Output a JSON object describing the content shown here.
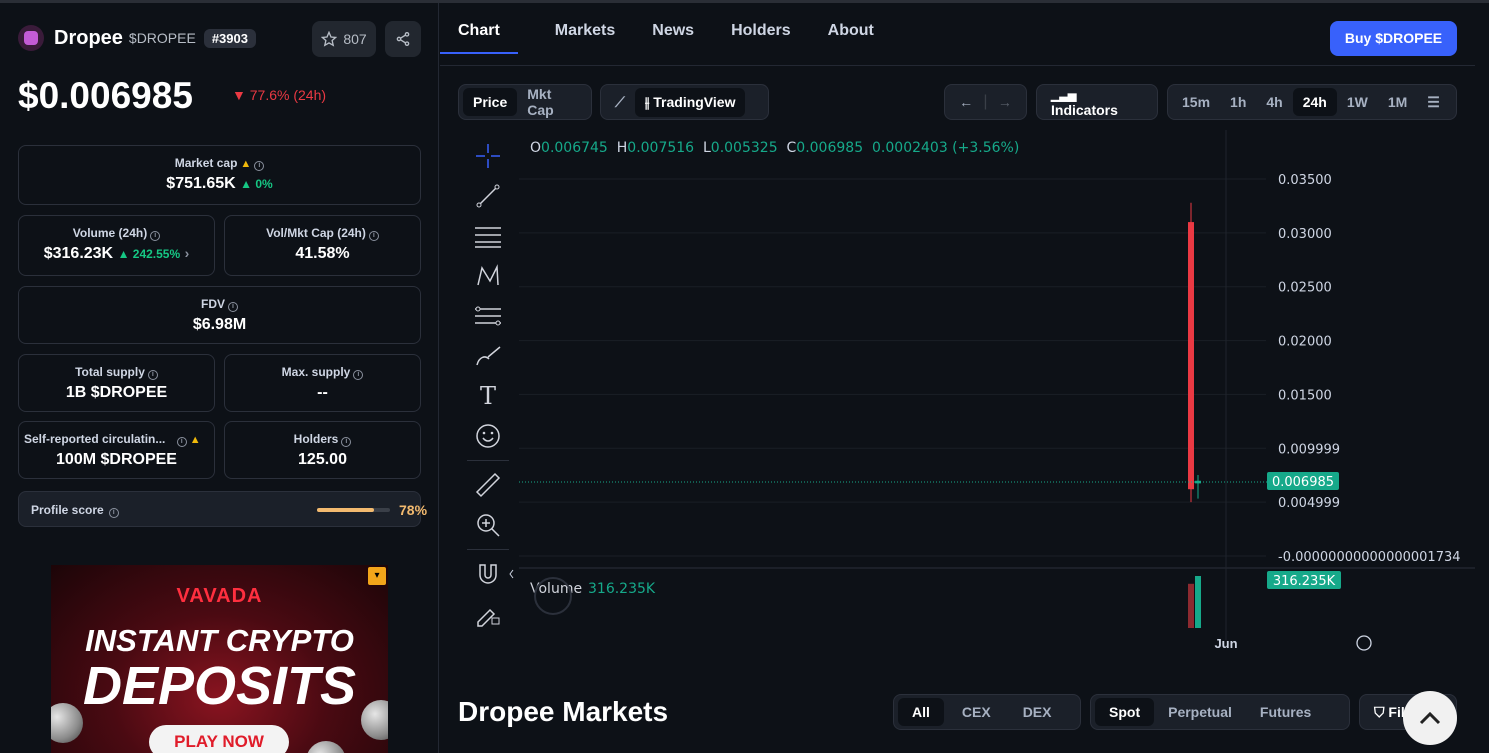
{
  "token": {
    "name": "Dropee",
    "symbol": "$DROPEE",
    "rank": "#3903",
    "watchlist_count": "807",
    "price": "$0.006985",
    "price_change": "77.6% (24h)"
  },
  "stats": {
    "market_cap": {
      "label": "Market cap",
      "value": "$751.65K",
      "change": "0%"
    },
    "volume": {
      "label": "Volume (24h)",
      "value": "$316.23K",
      "change": "242.55%"
    },
    "vol_mkt_cap": {
      "label": "Vol/Mkt Cap (24h)",
      "value": "41.58%"
    },
    "fdv": {
      "label": "FDV",
      "value": "$6.98M"
    },
    "total_supply": {
      "label": "Total supply",
      "value": "1B $DROPEE"
    },
    "max_supply": {
      "label": "Max. supply",
      "value": "--"
    },
    "circulating": {
      "label": "Self-reported circulatin...",
      "value": "100M $DROPEE"
    },
    "holders": {
      "label": "Holders",
      "value": "125.00"
    }
  },
  "profile": {
    "label": "Profile score",
    "value": "78%",
    "fraction": 0.78
  },
  "ad": {
    "brand": "VAVADA",
    "line1": "INSTANT CRYPTO",
    "line2": "DEPOSITS",
    "cta": "PLAY NOW"
  },
  "tabs": [
    "Chart",
    "Markets",
    "News",
    "Holders",
    "About"
  ],
  "buy_label": "Buy $DROPEE",
  "chart_controls": {
    "price": "Price",
    "mkt_cap": "Mkt Cap",
    "tradingview": "TradingView",
    "indicators": "Indicators",
    "intervals": [
      "15m",
      "1h",
      "4h",
      "24h",
      "1W",
      "1M"
    ],
    "active_interval": "24h"
  },
  "ohlc": {
    "o": "0.006745",
    "h": "0.007516",
    "l": "0.005325",
    "c": "0.006985",
    "chg": "0.0002403 (+3.56%)"
  },
  "volume_label": "Volume",
  "volume_value": "316.235K",
  "chart_data": {
    "type": "candlestick",
    "y_ticks": [
      "0.03500",
      "0.03000",
      "0.02500",
      "0.02000",
      "0.01500",
      "0.009999",
      "0.004999",
      "-0.00000000000000001734"
    ],
    "ylim": [
      0,
      0.035
    ],
    "x_label": "Jun",
    "current_price_tag": "0.006985",
    "volume_tag": "316.235K",
    "candles": [
      {
        "open": 0.031,
        "high": 0.0328,
        "low": 0.005,
        "close": 0.0062
      },
      {
        "open": 0.006745,
        "high": 0.007516,
        "low": 0.005325,
        "close": 0.006985
      }
    ],
    "volumes": [
      0.85,
      1.0
    ]
  },
  "markets": {
    "title": "Dropee Markets",
    "type_filters": [
      "All",
      "CEX",
      "DEX"
    ],
    "kind_filters": [
      "Spot",
      "Perpetual",
      "Futures"
    ],
    "filters_label": "Filters"
  },
  "colors": {
    "accent": "#3861fb",
    "up": "#16c784",
    "down": "#ea3943",
    "score": "#f3ba6f"
  }
}
